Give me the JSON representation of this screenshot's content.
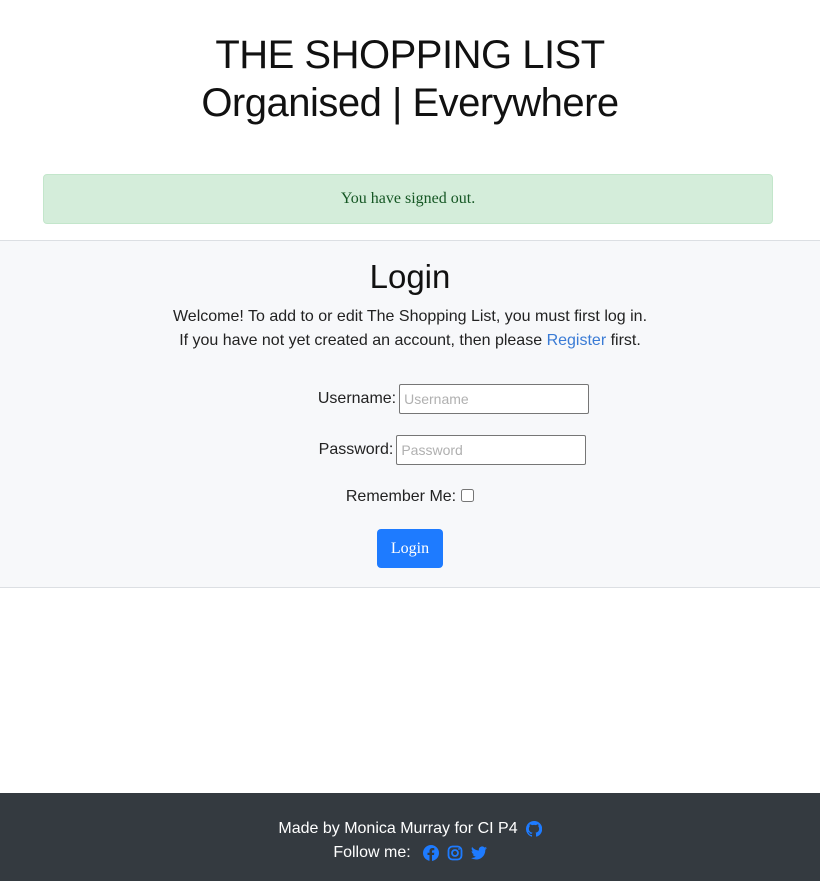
{
  "header": {
    "title": "THE SHOPPING LIST",
    "tagline": "Organised | Everywhere"
  },
  "alert": {
    "message": "You have signed out.",
    "color": "#155724",
    "background": "#d4edda"
  },
  "login": {
    "heading": "Login",
    "intro_line1": "Welcome! To add to or edit The Shopping List, you must first log in.",
    "intro_line2_prefix": "If you have not yet created an account, then please",
    "register_link": "Register",
    "intro_line2_suffix": "first.",
    "username_label": "Username:",
    "username_placeholder": "Username",
    "username_value": "",
    "password_label": "Password:",
    "password_placeholder": "Password",
    "password_value": "",
    "remember_label": "Remember Me:",
    "remember_checked": false,
    "submit_label": "Login",
    "accent_color": "#1e7bff"
  },
  "footer": {
    "credit": "Made by Monica Murray for CI P4",
    "follow_label": "Follow me:",
    "icons": [
      "github-icon",
      "facebook-icon",
      "instagram-icon",
      "twitter-icon"
    ],
    "icon_color": "#1e7bff",
    "background": "#343a40"
  }
}
